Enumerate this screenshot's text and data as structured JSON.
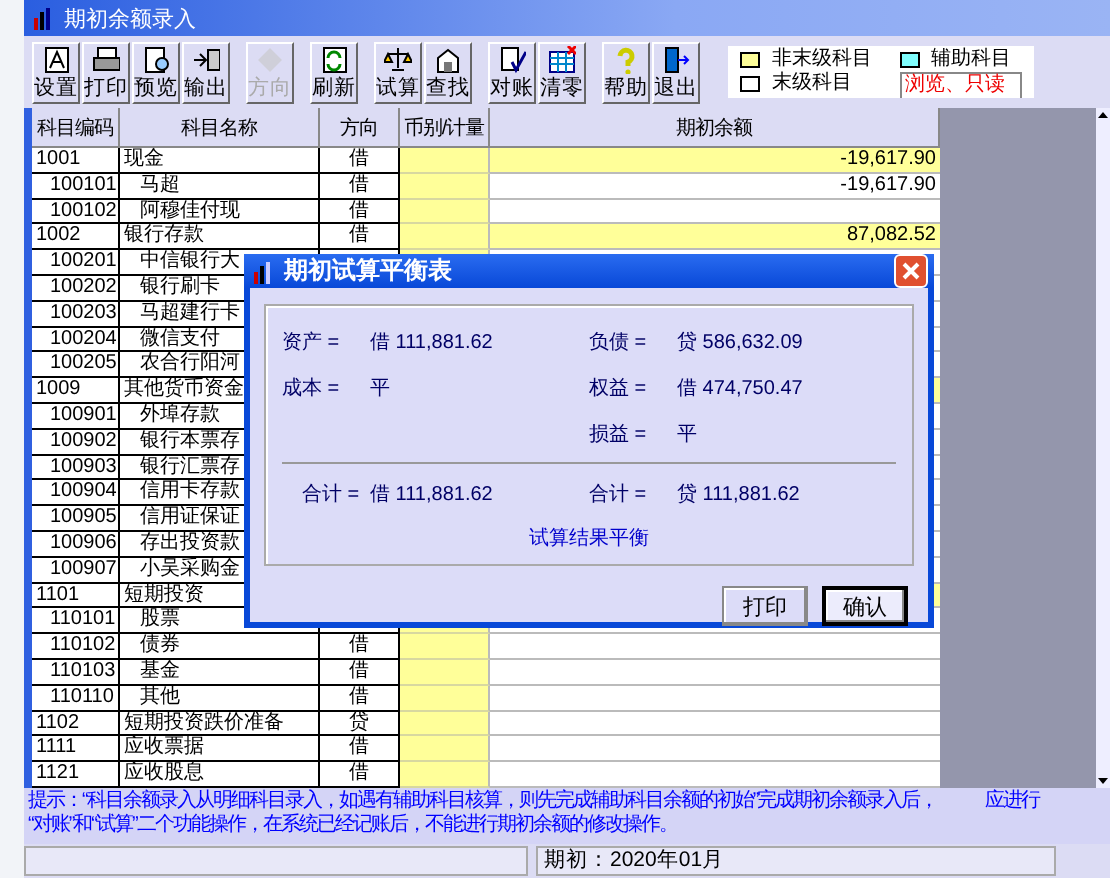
{
  "window": {
    "title": "期初余额录入"
  },
  "toolbar_groups": [
    [
      {
        "label": "设置",
        "disabled": false
      },
      {
        "label": "打印",
        "disabled": false
      },
      {
        "label": "预览",
        "disabled": false
      },
      {
        "label": "输出",
        "disabled": false
      }
    ],
    [
      {
        "label": "方向",
        "disabled": true
      }
    ],
    [
      {
        "label": "刷新",
        "disabled": false
      }
    ],
    [
      {
        "label": "试算",
        "disabled": false
      },
      {
        "label": "查找",
        "disabled": false
      }
    ],
    [
      {
        "label": "对账",
        "disabled": false
      },
      {
        "label": "清零",
        "disabled": false
      }
    ],
    [
      {
        "label": "帮助",
        "disabled": false
      },
      {
        "label": "退出",
        "disabled": false
      }
    ]
  ],
  "legend": [
    {
      "label": "非末级科目",
      "color": "#ffff99"
    },
    {
      "label": "辅助科目",
      "color": "#80ffff"
    },
    {
      "label": "末级科目",
      "color": "#ffffff"
    }
  ],
  "mode_badge": "浏览、只读",
  "table": {
    "columns": [
      "科目编码",
      "科目名称",
      "方向",
      "币别/计量",
      "期初余额"
    ],
    "rows": [
      {
        "code": "1001",
        "name": "现金",
        "direction": "借",
        "balance": "-19,617.90",
        "children": [
          {
            "code": "100101",
            "name": "马超",
            "direction": "借",
            "balance": "-19,617.90"
          },
          {
            "code": "100102",
            "name": "阿穆佳付现",
            "direction": "借"
          }
        ]
      },
      {
        "code": "1002",
        "name": "银行存款",
        "direction": "借",
        "balance": "87,082.52",
        "children": [
          {
            "code": "100201",
            "name": "中信银行大"
          },
          {
            "code": "100202",
            "name": "银行刷卡"
          },
          {
            "code": "100203",
            "name": "马超建行卡"
          },
          {
            "code": "100204",
            "name": "微信支付"
          },
          {
            "code": "100205",
            "name": "农合行阳河"
          }
        ]
      },
      {
        "code": "1009",
        "name": "其他货币资金",
        "children": [
          {
            "code": "100901",
            "name": "外埠存款"
          },
          {
            "code": "100902",
            "name": "银行本票存"
          },
          {
            "code": "100903",
            "name": "银行汇票存"
          },
          {
            "code": "100904",
            "name": "信用卡存款"
          },
          {
            "code": "100905",
            "name": "信用证保证"
          },
          {
            "code": "100906",
            "name": "存出投资款"
          },
          {
            "code": "100907",
            "name": "小吴采购金"
          }
        ]
      },
      {
        "code": "1101",
        "name": "短期投资",
        "children": [
          {
            "code": "110101",
            "name": "股票"
          },
          {
            "code": "110102",
            "name": "债券",
            "direction": "借"
          },
          {
            "code": "110103",
            "name": "基金",
            "direction": "借"
          },
          {
            "code": "110110",
            "name": "其他",
            "direction": "借"
          }
        ]
      },
      {
        "code": "1102",
        "name": "短期投资跌价准备",
        "direction": "贷"
      },
      {
        "code": "1111",
        "name": "应收票据",
        "direction": "借"
      },
      {
        "code": "1121",
        "name": "应收股息",
        "direction": "借"
      }
    ]
  },
  "dialog": {
    "title": "期初试算平衡表",
    "left": [
      {
        "label": "资产 =",
        "value": "借 111,881.62"
      },
      {
        "label": "成本 =",
        "value": "平"
      }
    ],
    "right": [
      {
        "label": "负债 =",
        "value": "贷 586,632.09"
      },
      {
        "label": "权益 =",
        "value": "借 474,750.47"
      },
      {
        "label": "损益 =",
        "value": "平"
      }
    ],
    "total_left": {
      "label": "合计 =",
      "value": "借 111,881.62"
    },
    "total_right": {
      "label": "合计 =",
      "value": "贷 111,881.62"
    },
    "result": "试算结果平衡",
    "buttons": [
      {
        "label": "打印",
        "focused": false
      },
      {
        "label": "确认",
        "focused": true
      }
    ]
  },
  "tip": {
    "line_1": "提示：“科目余额录入从明细科目录入，如遇有辅助科目核算，则先完成辅助科目余额的初始”完成期初余额录入后，",
    "line_1_end": "应进行",
    "line_2": "“对账”和“试算”二个功能操作，在系统已经记账后，不能进行期初余额的修改操作。"
  },
  "status_bar": {
    "period": "期初：2020年01月"
  }
}
